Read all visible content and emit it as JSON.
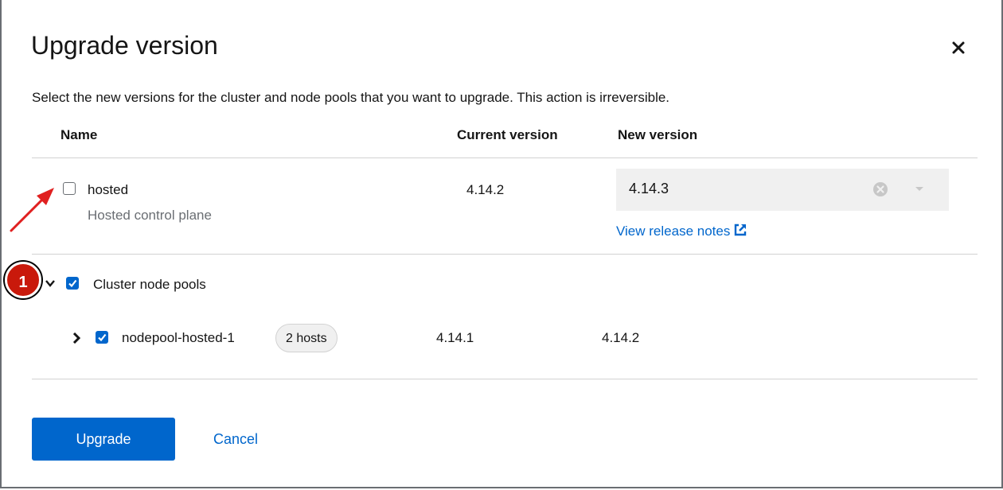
{
  "modal": {
    "title": "Upgrade version",
    "description": "Select the new versions for the cluster and node pools that you want to upgrade. This action is irreversible."
  },
  "table": {
    "headers": {
      "name": "Name",
      "current": "Current version",
      "new": "New version"
    },
    "control_plane": {
      "name": "hosted",
      "subtitle": "Hosted control plane",
      "checked": false,
      "current_version": "4.14.2",
      "new_version": "4.14.3",
      "release_notes_label": "View release notes"
    },
    "node_pools_group": {
      "label": "Cluster node pools",
      "checked": true
    },
    "node_pool": {
      "name": "nodepool-hosted-1",
      "hosts_badge": "2 hosts",
      "checked": true,
      "current_version": "4.14.1",
      "new_version": "4.14.2"
    }
  },
  "footer": {
    "primary_label": "Upgrade",
    "secondary_label": "Cancel"
  },
  "annotation": {
    "callout_number": "1",
    "color": "#c9190b"
  },
  "colors": {
    "accent": "#0066cc",
    "text": "#151515",
    "muted": "#6a6e73",
    "divider": "#d2d2d2"
  },
  "icons": [
    "close-icon",
    "clear-icon",
    "caret-down-icon",
    "external-link-icon",
    "chevron-right-icon",
    "chevron-down-icon",
    "checkmark-icon",
    "arrow-icon"
  ]
}
